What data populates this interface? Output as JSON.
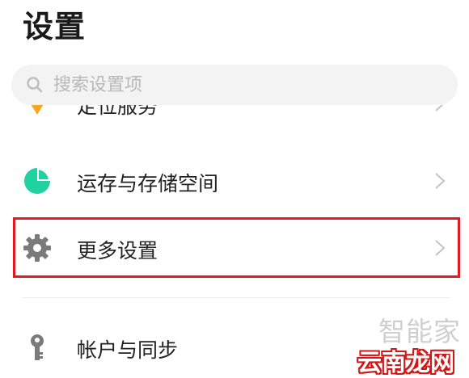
{
  "header": {
    "title": "设置"
  },
  "search": {
    "placeholder": "搜索设置项",
    "value": "",
    "icon": "search-icon"
  },
  "settings": {
    "items": [
      {
        "label": "定位服务",
        "icon": "location-icon",
        "icon_color": "#f5a623",
        "partially_visible": true
      },
      {
        "label": "运存与存储空间",
        "icon": "storage-pie-icon",
        "icon_color": "#1fd2a0"
      },
      {
        "label": "更多设置",
        "icon": "gear-icon",
        "icon_color": "#7a7a7a",
        "highlighted": true,
        "highlight_color": "#e01b24"
      },
      {
        "label": "帐户与同步",
        "icon": "key-icon",
        "icon_color": "#7a7a7a"
      }
    ]
  },
  "watermark": {
    "text": "智能家",
    "site": "云南龙网"
  }
}
